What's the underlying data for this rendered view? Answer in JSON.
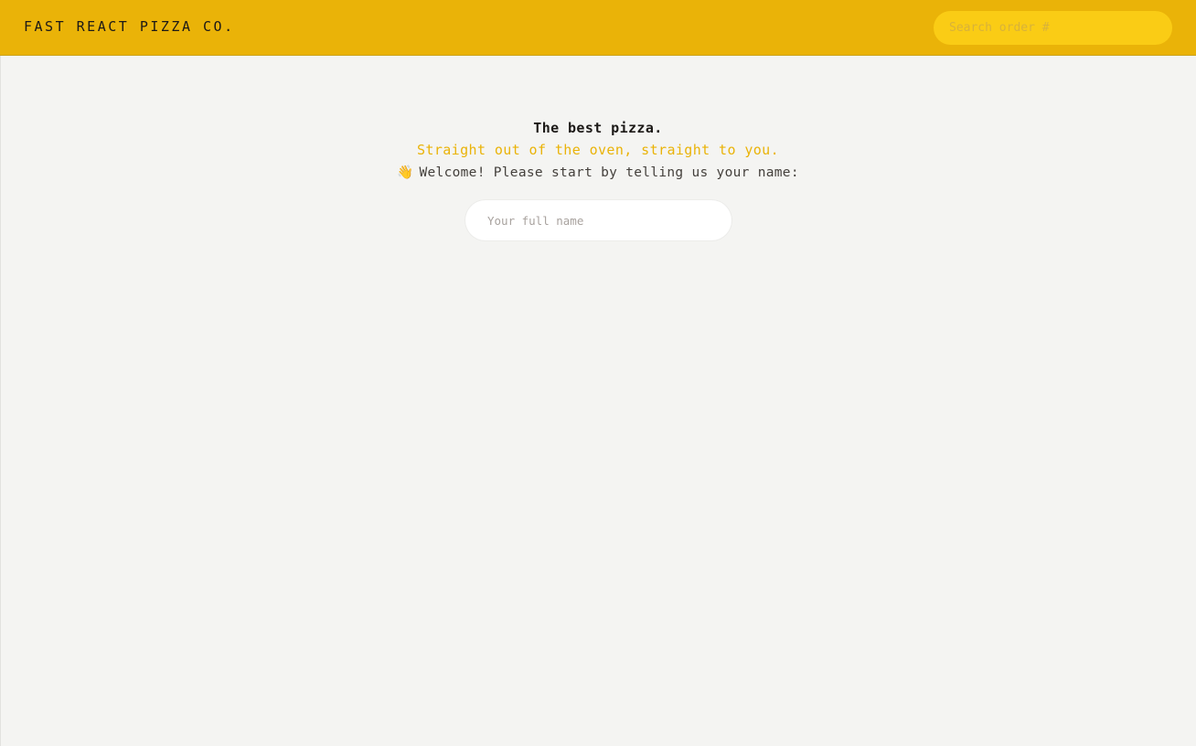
{
  "header": {
    "logo": "FAST REACT PIZZA CO.",
    "search_placeholder": "Search order #",
    "background_color": "#eab308"
  },
  "home": {
    "title": "The best pizza.",
    "subtitle": "Straight out of the oven, straight to you.",
    "welcome_emoji": "👋",
    "welcome_text": "Welcome! Please start by telling us your name:",
    "name_input_placeholder": "Your full name",
    "accent_color": "#eab308"
  }
}
